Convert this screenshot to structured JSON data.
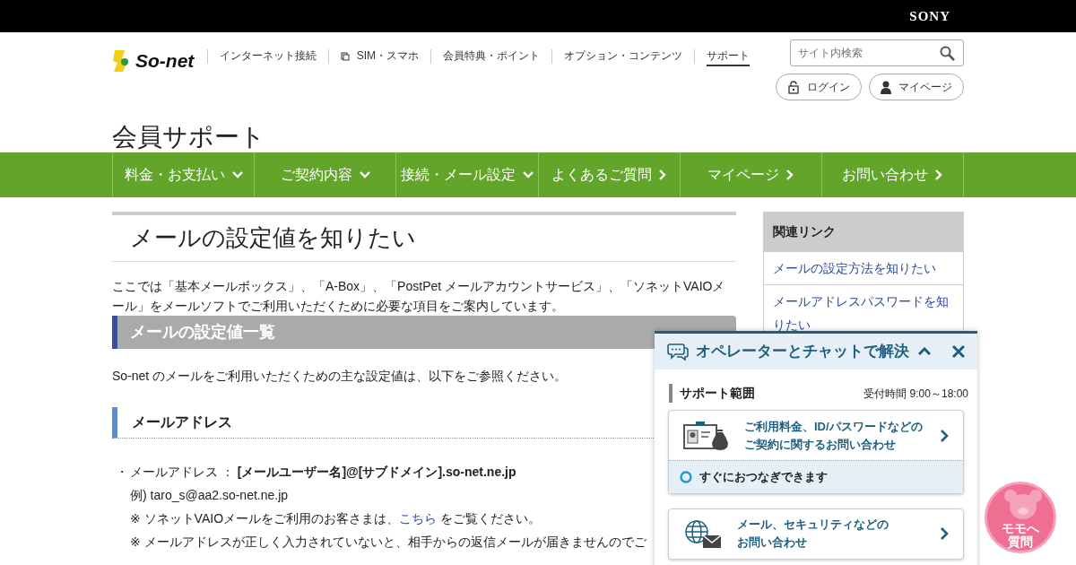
{
  "top_bar": {
    "brand": "SONY"
  },
  "header": {
    "logo": "So-net",
    "nav": [
      {
        "label": "インターネット接続",
        "selected": false,
        "icon": false
      },
      {
        "label": "SIM・スマホ",
        "selected": false,
        "icon": true
      },
      {
        "label": "会員特典・ポイント",
        "selected": false,
        "icon": false
      },
      {
        "label": "オプション・コンテンツ",
        "selected": false,
        "icon": false
      },
      {
        "label": "サポート",
        "selected": true,
        "icon": false
      }
    ],
    "search": {
      "placeholder": "サイト内検索"
    },
    "buttons": [
      {
        "label": "ログイン",
        "kind": "lock"
      },
      {
        "label": "マイページ",
        "kind": "person"
      }
    ]
  },
  "section_title": "会員サポート",
  "main_nav": [
    {
      "label": "料金・お支払い",
      "kind": "dropdown"
    },
    {
      "label": "ご契約内容",
      "kind": "dropdown"
    },
    {
      "label": "接続・メール設定",
      "kind": "dropdown"
    },
    {
      "label": "よくあるご質問",
      "kind": "link"
    },
    {
      "label": "マイページ",
      "kind": "link"
    },
    {
      "label": "お問い合わせ",
      "kind": "link"
    }
  ],
  "article": {
    "title": "メールの設定値を知りたい",
    "intro": "ここでは「基本メールボックス」、「A-Box」、「PostPet メールアカウントサービス」、「ソネットVAIOメール」をメールソフトでご利用いただくために必要な項目をご案内しています。",
    "heading": "メールの設定値一覧",
    "lead": "So-net のメールをご利用いただくための主な設定値は、以下をご参照ください。",
    "subheading": "メールアドレス",
    "item": {
      "bullet": "・",
      "label": "メールアドレス ：",
      "value": "[メールユーザー名]@[サブドメイン].so-net.ne.jp",
      "example": "例) taro_s@aa2.so-net.ne.jp",
      "note_before": "※ ソネットVAIOメールをご利用のお客さまは、",
      "note_link": "こちら",
      "note_after": " をご覧ください。",
      "note2": "※ メールアドレスが正しく入力されていないと、相手からの返信メールが届きませんのでご"
    }
  },
  "sidebar": {
    "title": "関連リンク",
    "links": [
      "メールの設定方法を知りたい",
      "メールアドレスパスワードを知りたい"
    ]
  },
  "chat": {
    "title": "オペレーターとチャットで解決",
    "range_label": "サポート範囲",
    "hours": "受付時間 9:00～18:00",
    "cards": [
      {
        "kind": "contract",
        "text": [
          "ご利用料金、ID/パスワードなどの",
          "ご契約に関するお問い合わせ"
        ],
        "status": "すぐにおつなぎできます"
      },
      {
        "kind": "mail",
        "text": [
          "メール、セキュリティなどの",
          "お問い合わせ"
        ]
      }
    ]
  },
  "mascot_button": {
    "label": [
      "モモへ",
      "質問"
    ]
  }
}
